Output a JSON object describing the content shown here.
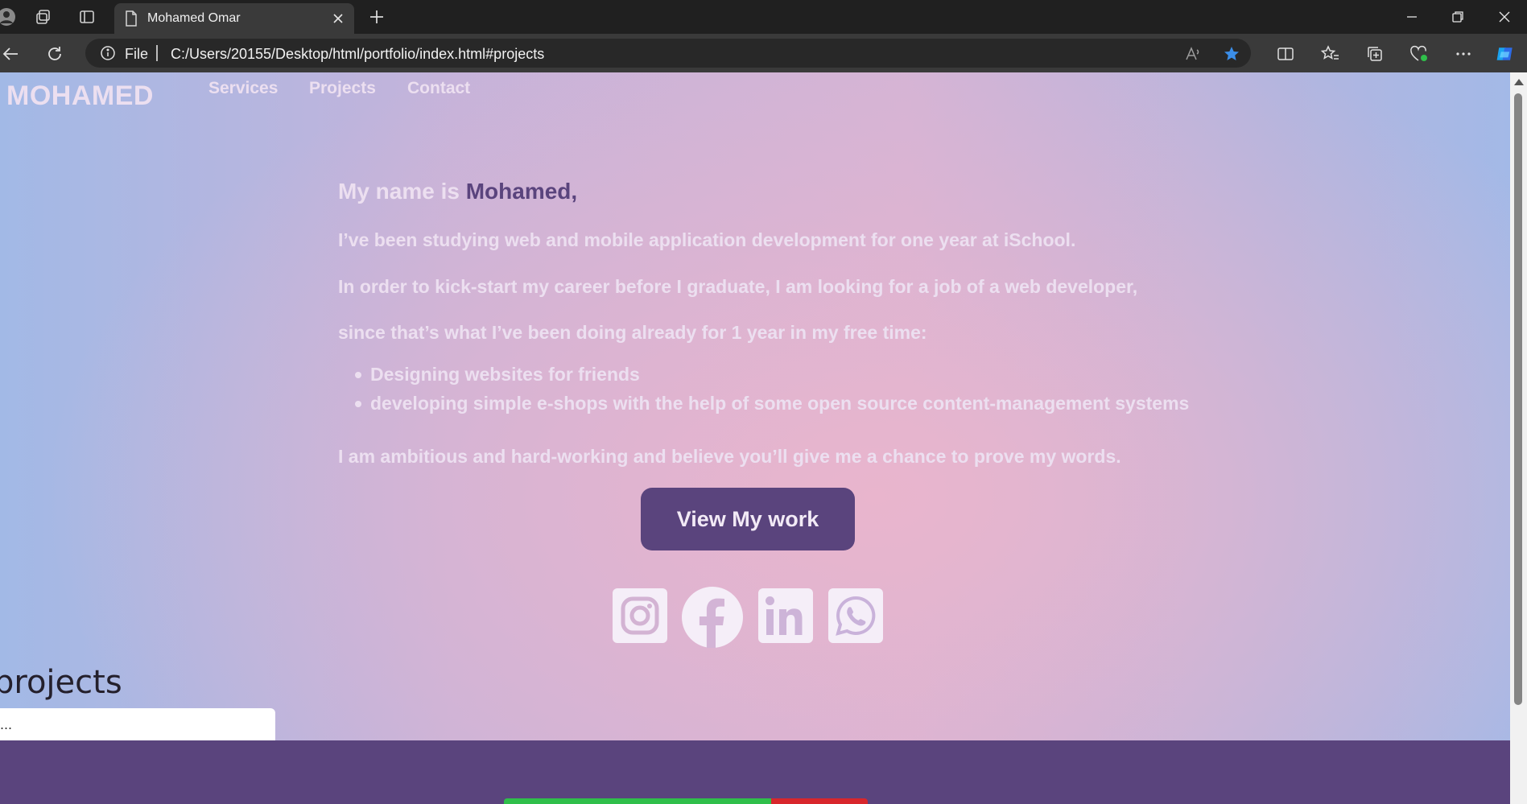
{
  "browser": {
    "tab_title": "Mohamed Omar",
    "omnibox": {
      "scheme_label": "File",
      "url": "C:/Users/20155/Desktop/html/portfolio/index.html#projects"
    },
    "accent_color": "#0a84ff"
  },
  "site": {
    "logo": "MOHAMED",
    "nav": [
      "Services",
      "Projects",
      "Contact"
    ],
    "intro": {
      "prefix": "My name is ",
      "name": "Mohamed,",
      "line1": "I’ve been studying web and mobile application development for one year at iSchool.",
      "line2": "In order to kick-start my career before I graduate, I am looking for a job of a web developer,",
      "line3": "since that’s what I’ve been doing already for 1 year in my free time:",
      "bullets": [
        "Designing websites for friends",
        "developing simple e-shops with the help of some open source content-management systems"
      ],
      "closing": "I am ambitious and hard-working and believe you’ll give me a chance to prove my words."
    },
    "cta_label": "View My work",
    "social_icons": [
      "instagram-icon",
      "facebook-icon",
      "linkedin-icon",
      "whatsapp-icon"
    ],
    "projects": {
      "heading": "projects",
      "input_value": "..."
    },
    "colors": {
      "brand_purple": "#5a447d",
      "text_light": "#ecdff0",
      "green": "#2fbf4a",
      "red": "#d8262c"
    }
  }
}
